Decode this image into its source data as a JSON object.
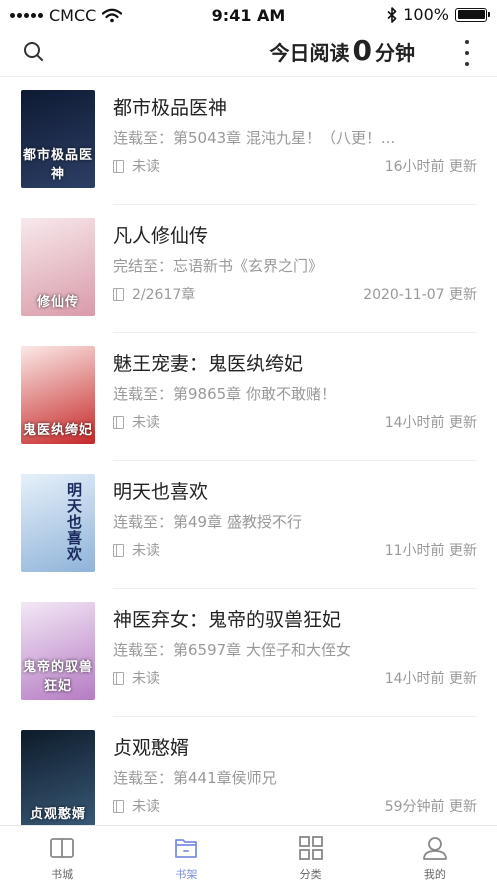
{
  "status_bar": {
    "carrier": "CMCC",
    "time": "9:41 AM",
    "battery": "100%",
    "battery_level": 1.0
  },
  "header": {
    "reading_prefix": "今日阅读",
    "reading_minutes": "0",
    "reading_suffix": "分钟",
    "search_icon": "search-icon",
    "more_icon": "more-vertical-icon"
  },
  "books": [
    {
      "title": "都市极品医神",
      "progress": "连载至：第5043章 混沌九星！（八更！...",
      "read_state": "未读",
      "updated": "16小时前 更新",
      "cover_text": "都市极品医神",
      "cover_colors": [
        "#0e1a33",
        "#2d3f66"
      ],
      "cover_text_style": "bottom"
    },
    {
      "title": "凡人修仙传",
      "progress": "完结至：忘语新书《玄界之门》",
      "read_state": "2/2617章",
      "updated": "2020-11-07 更新",
      "cover_text": "修仙传",
      "cover_colors": [
        "#f7e9ec",
        "#d99aa8"
      ],
      "cover_text_style": "bottom"
    },
    {
      "title": "魅王宠妻：鬼医纨绔妃",
      "progress": "连载至：第9865章 你敢不敢赌！",
      "read_state": "未读",
      "updated": "14小时前 更新",
      "cover_text": "鬼医纨绔妃",
      "cover_colors": [
        "#fbe9e7",
        "#c62828"
      ],
      "cover_text_style": "bottom"
    },
    {
      "title": "明天也喜欢",
      "progress": "连载至：第49章 盛教授不行",
      "read_state": "未读",
      "updated": "11小时前 更新",
      "cover_text": "明天也喜欢",
      "cover_colors": [
        "#e6f0fa",
        "#8fb3d9"
      ],
      "cover_text_style": "vertical"
    },
    {
      "title": "神医弃女：鬼帝的驭兽狂妃",
      "progress": "连载至：第6597章 大侄子和大侄女",
      "read_state": "未读",
      "updated": "14小时前 更新",
      "cover_text": "鬼帝的驭兽狂妃",
      "cover_colors": [
        "#f3e8f5",
        "#b57bc4"
      ],
      "cover_text_style": "bottom"
    },
    {
      "title": "贞观憨婿",
      "progress": "连载至：第441章侯师兄",
      "read_state": "未读",
      "updated": "59分钟前 更新",
      "cover_text": "贞观憨婿",
      "cover_colors": [
        "#0d1b2a",
        "#3a5a78"
      ],
      "cover_text_style": "bottom"
    }
  ],
  "tabs": [
    {
      "label": "书城",
      "icon": "book-open-icon",
      "active": false
    },
    {
      "label": "书架",
      "icon": "bookshelf-icon",
      "active": true
    },
    {
      "label": "分类",
      "icon": "grid-icon",
      "active": false
    },
    {
      "label": "我的",
      "icon": "user-icon",
      "active": false
    }
  ],
  "colors": {
    "accent": "#7a8fe0",
    "text_primary": "#222222",
    "text_secondary": "#999999",
    "divider": "#eeeeee"
  }
}
